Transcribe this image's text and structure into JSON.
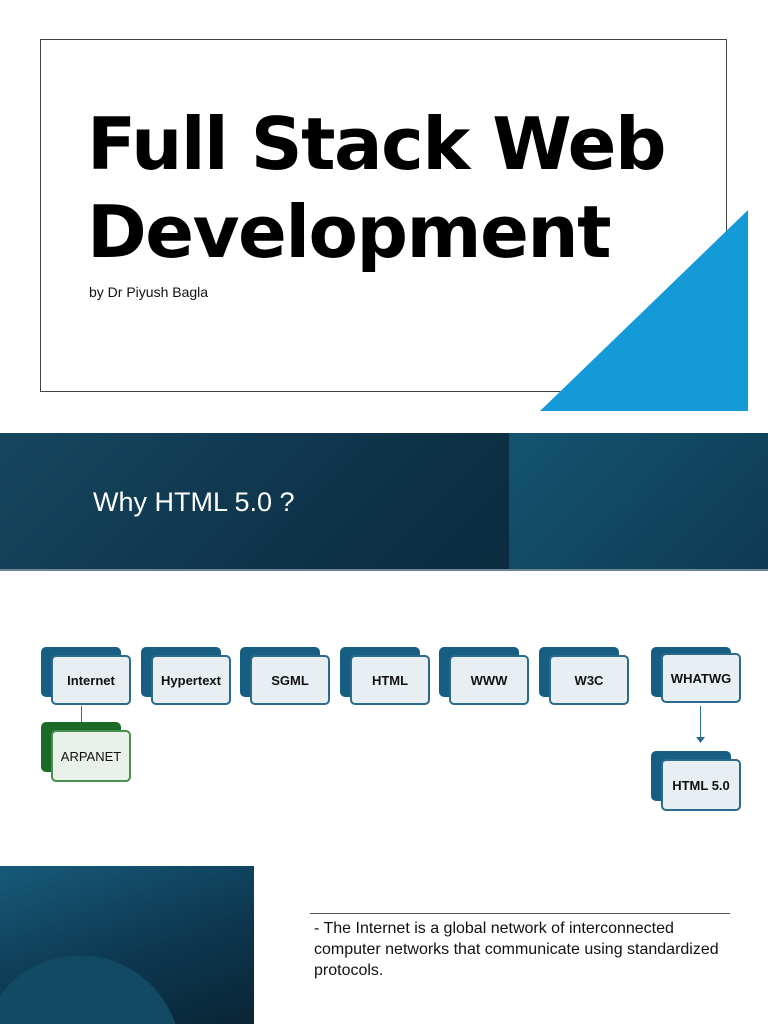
{
  "slide1": {
    "title_line1": "Full Stack Web",
    "title_line2": "Development",
    "author": "by Dr Piyush Bagla",
    "accent_color": "#149bd7"
  },
  "slide2": {
    "title": "Why HTML 5.0 ?"
  },
  "diagram": {
    "nodes": [
      "Internet",
      "Hypertext",
      "SGML",
      "HTML",
      "WWW",
      "W3C",
      "WHATWG"
    ],
    "child_of_internet": "ARPANET",
    "child_of_whatwg": "HTML 5.0"
  },
  "slide3": {
    "text": "- The Internet is a global network of interconnected computer networks that communicate using standardized protocols."
  }
}
